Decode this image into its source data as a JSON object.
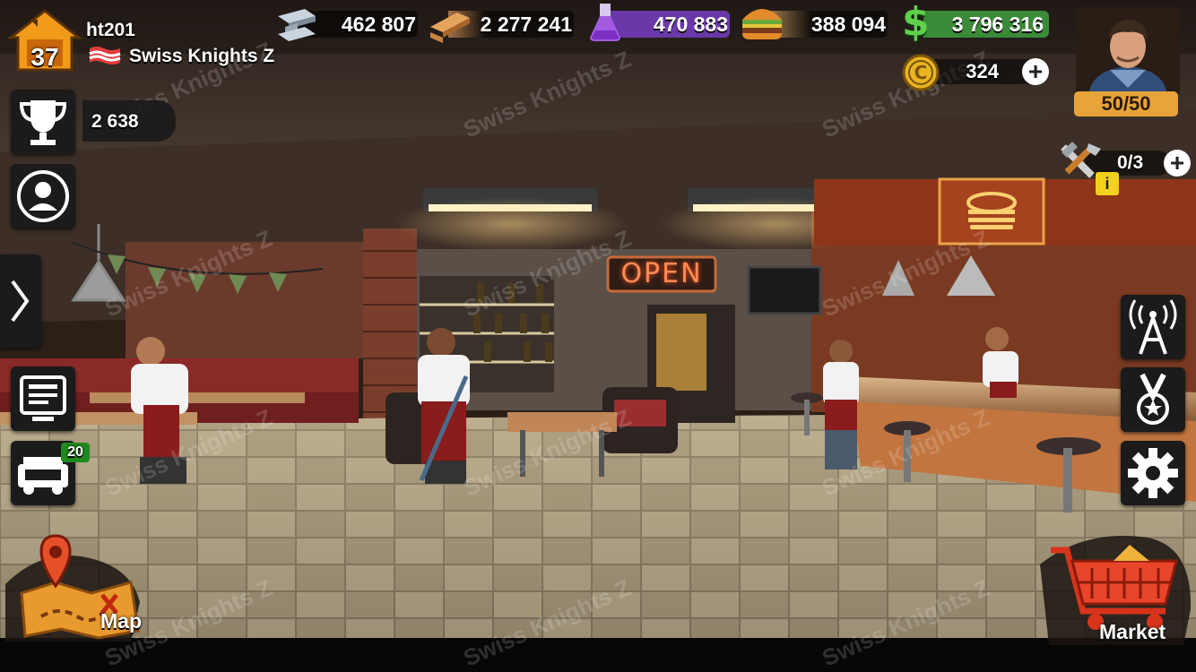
{
  "player": {
    "name": "ht201",
    "level": "37",
    "clan": "Swiss Knights Z",
    "trophies": "2 638",
    "energy": "50/50"
  },
  "resources": {
    "steel": "462 807",
    "wood": "2 277 241",
    "chemicals": "470 883",
    "food": "388 094",
    "cash": "3 796 316",
    "coins": "324"
  },
  "builders": {
    "count": "0/3",
    "badge": "i"
  },
  "left_menu": {
    "garage_badge": "20"
  },
  "scene": {
    "sign": "OPEN"
  },
  "buttons": {
    "map_label": "Map",
    "market_label": "Market"
  },
  "watermark": "Swiss Knights Z",
  "colors": {
    "level_badge": "#f29a1a",
    "energy_bar": "#e8a43a",
    "chemicals_bar": "#7b3fbf",
    "cash_bar": "#3f9a3c",
    "coin": "#e8b521"
  }
}
